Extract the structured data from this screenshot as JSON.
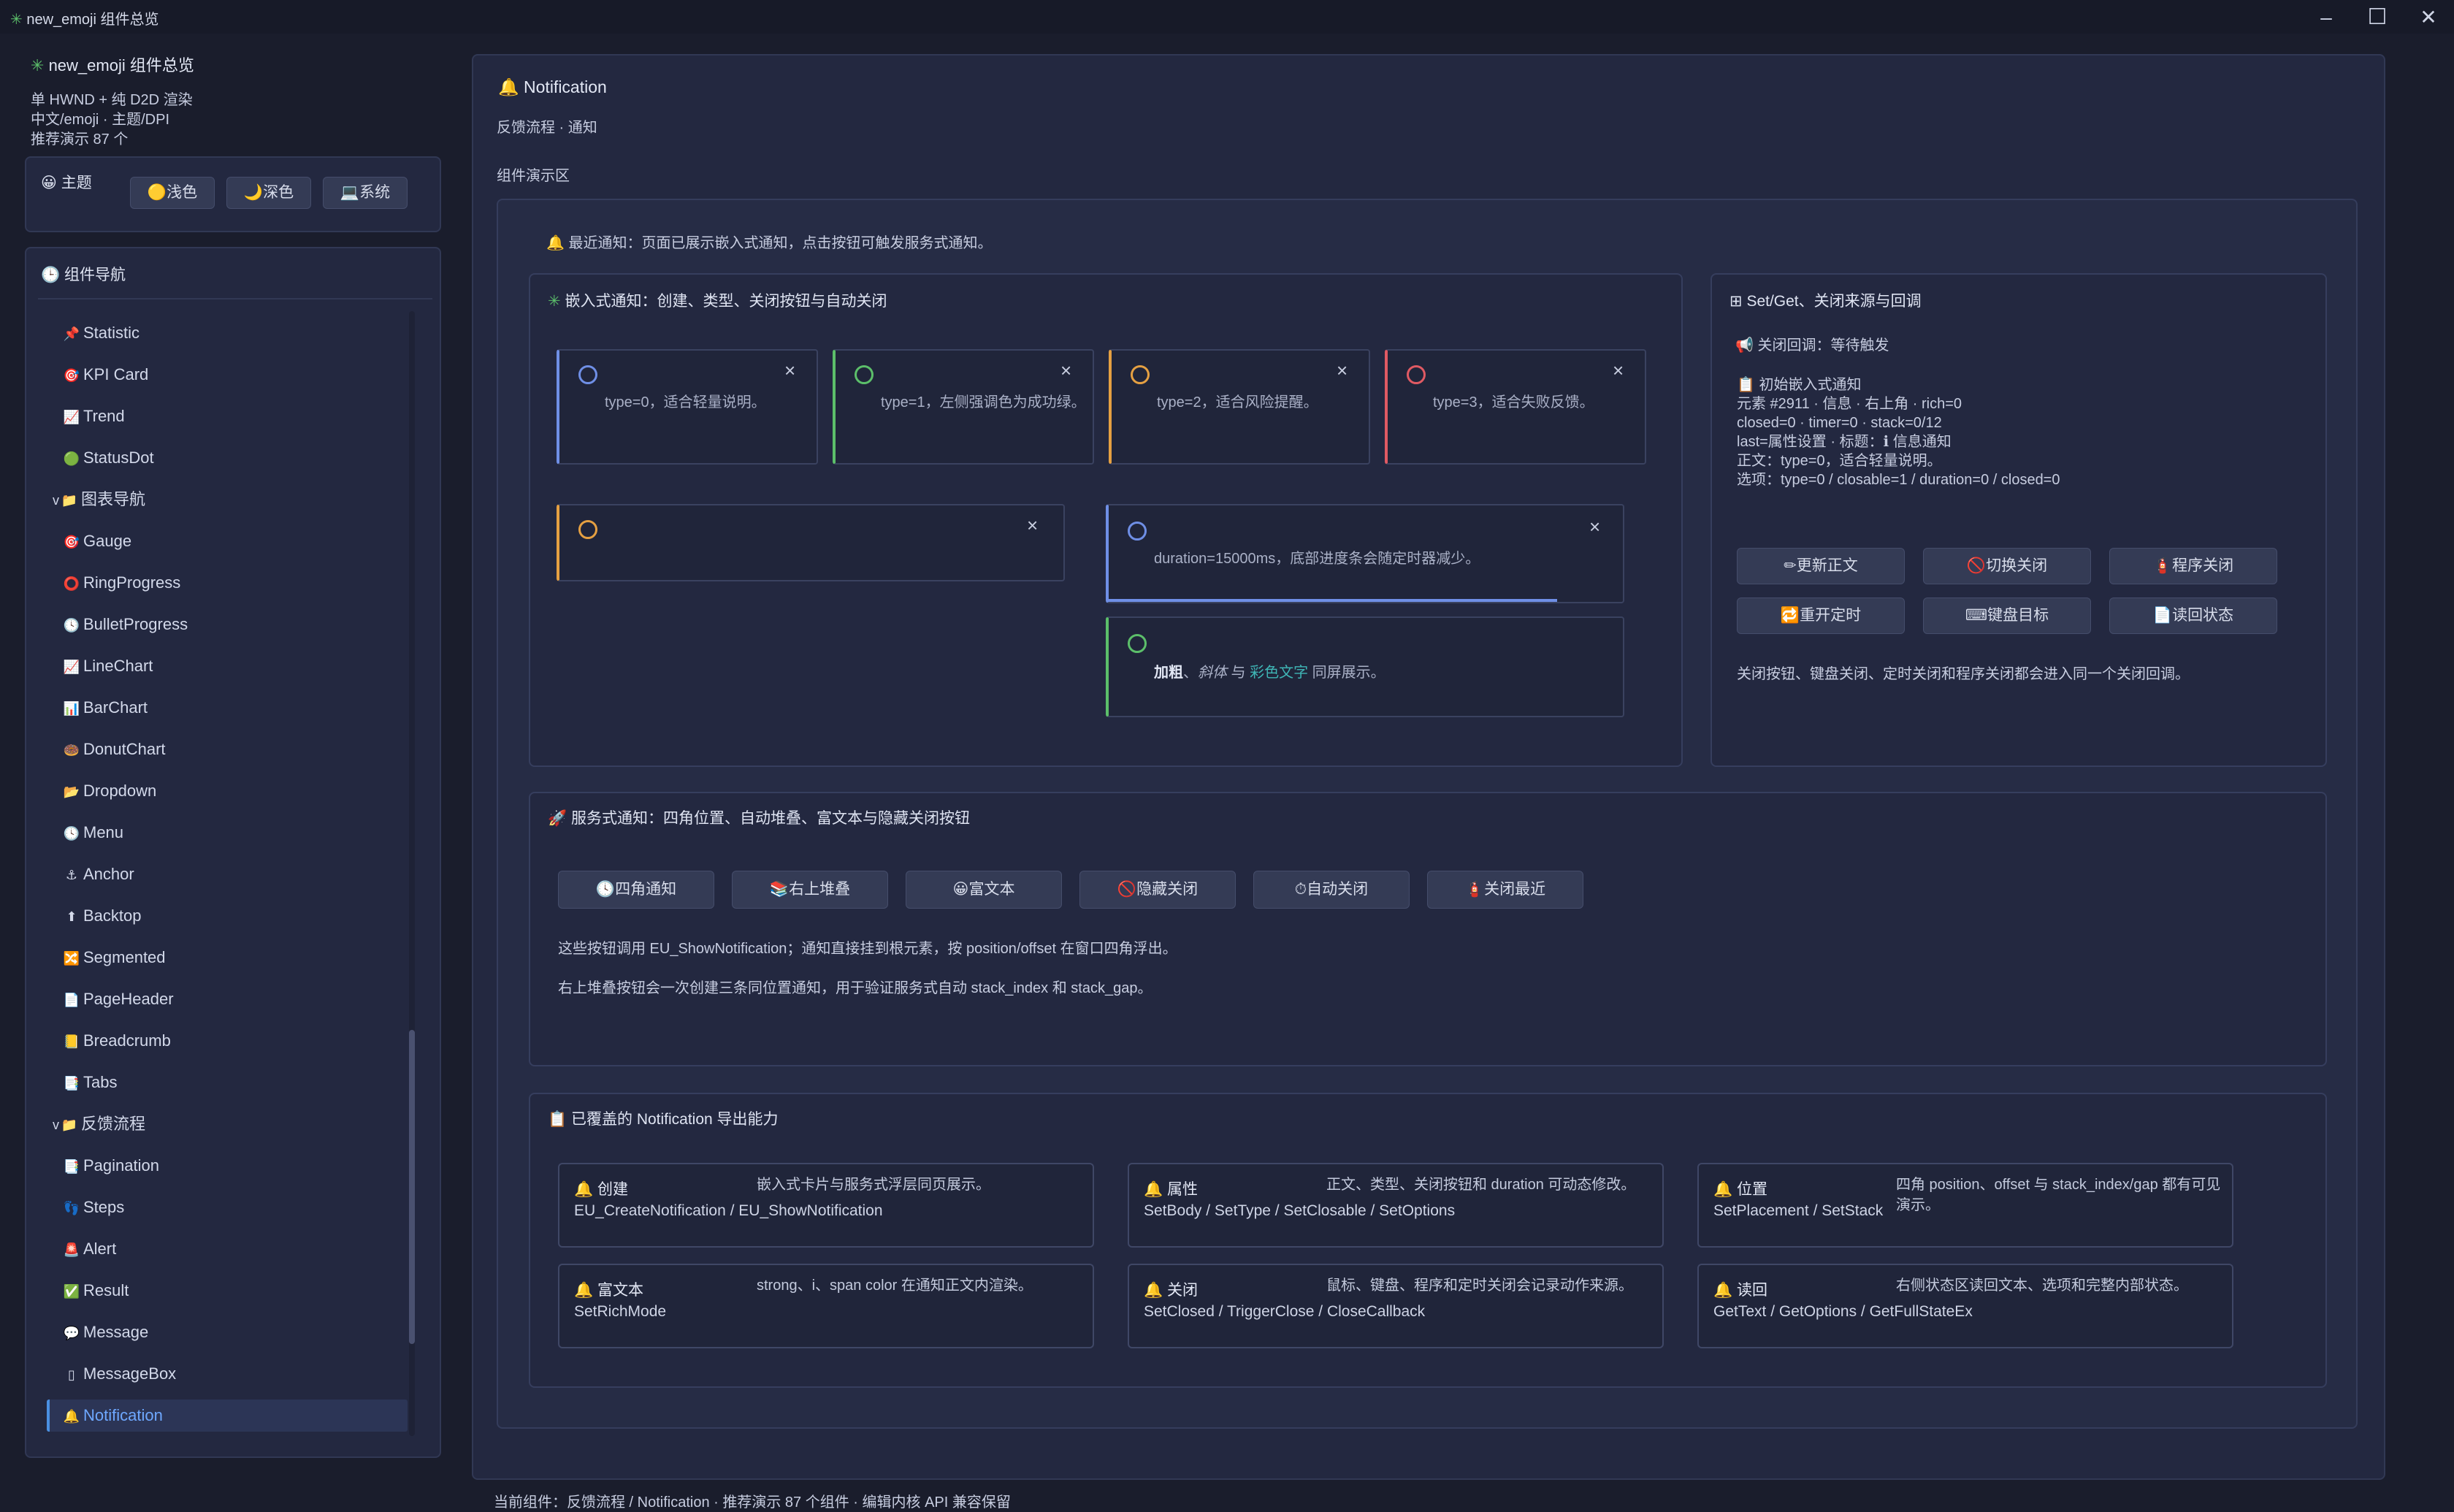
{
  "window": {
    "title": "new_emoji 组件总览"
  },
  "sidebar": {
    "app_title": "new_emoji 组件总览",
    "info": [
      "单 HWND + 纯 D2D 渲染",
      "中文/emoji · 主题/DPI",
      "推荐演示 87 个"
    ],
    "theme": {
      "label": "主题",
      "light": "浅色",
      "dark": "深色",
      "system": "系统"
    },
    "nav_title": "组件导航",
    "items": [
      {
        "label": "Statistic",
        "icon": "📌",
        "type": "item"
      },
      {
        "label": "KPI Card",
        "icon": "🎯",
        "type": "item"
      },
      {
        "label": "Trend",
        "icon": "📈",
        "type": "item"
      },
      {
        "label": "StatusDot",
        "icon": "🟢",
        "type": "item"
      },
      {
        "label": "图表导航",
        "icon": "📁",
        "type": "group"
      },
      {
        "label": "Gauge",
        "icon": "🎯",
        "type": "item"
      },
      {
        "label": "RingProgress",
        "icon": "⭕",
        "type": "item"
      },
      {
        "label": "BulletProgress",
        "icon": "🕓",
        "type": "item"
      },
      {
        "label": "LineChart",
        "icon": "📈",
        "type": "item"
      },
      {
        "label": "BarChart",
        "icon": "📊",
        "type": "item"
      },
      {
        "label": "DonutChart",
        "icon": "🍩",
        "type": "item"
      },
      {
        "label": "Dropdown",
        "icon": "📂",
        "type": "item"
      },
      {
        "label": "Menu",
        "icon": "🕓",
        "type": "item"
      },
      {
        "label": "Anchor",
        "icon": "⚓",
        "type": "item"
      },
      {
        "label": "Backtop",
        "icon": "⬆",
        "type": "item"
      },
      {
        "label": "Segmented",
        "icon": "🔀",
        "type": "item"
      },
      {
        "label": "PageHeader",
        "icon": "📄",
        "type": "item"
      },
      {
        "label": "Breadcrumb",
        "icon": "📒",
        "type": "item"
      },
      {
        "label": "Tabs",
        "icon": "📑",
        "type": "item"
      },
      {
        "label": "反馈流程",
        "icon": "📁",
        "type": "group"
      },
      {
        "label": "Pagination",
        "icon": "📑",
        "type": "item"
      },
      {
        "label": "Steps",
        "icon": "👣",
        "type": "item"
      },
      {
        "label": "Alert",
        "icon": "🚨",
        "type": "item"
      },
      {
        "label": "Result",
        "icon": "✅",
        "type": "item"
      },
      {
        "label": "Message",
        "icon": "💬",
        "type": "item"
      },
      {
        "label": "MessageBox",
        "icon": "▯",
        "type": "item"
      },
      {
        "label": "Notification",
        "icon": "🔔",
        "type": "item",
        "selected": true
      }
    ]
  },
  "main": {
    "title": "Notification",
    "subtitle": "反馈流程 · 通知",
    "demo_label": "组件演示区",
    "recent": "最近通知：页面已展示嵌入式通知，点击按钮可触发服务式通知。",
    "embedded": {
      "title": "嵌入式通知：创建、类型、关闭按钮与自动关闭",
      "cards": [
        {
          "text": "type=0，适合轻量说明。",
          "color": "#6f8fe6"
        },
        {
          "text": "type=1，左侧强调色为成功绿。",
          "color": "#5cbf6a"
        },
        {
          "text": "type=2，适合风险提醒。",
          "color": "#e5a042"
        },
        {
          "text": "type=3，适合失败反馈。",
          "color": "#e05a63"
        }
      ],
      "duration_text": "duration=15000ms，底部进度条会随定时器减少。",
      "rich": {
        "bold": "加粗",
        "sep1": "、",
        "italic": "斜体",
        "sep2": " 与 ",
        "colored": "彩色文字",
        "tail": " 同屏展示。"
      },
      "close_glyph": "×"
    },
    "setget": {
      "title": "Set/Get、关闭来源与回调",
      "callback": "关闭回调：等待触发",
      "lines": [
        "初始嵌入式通知",
        "元素 #2911 · 信息 · 右上角 · rich=0",
        "closed=0 · timer=0 · stack=0/12",
        "last=属性设置 · 标题：ℹ 信息通知",
        "正文：type=0，适合轻量说明。",
        "选项：type=0 / closable=1 / duration=0 / closed=0"
      ],
      "buttons": [
        "✏更新正文",
        "🚫切换关闭",
        "🧯程序关闭",
        "🔁重开定时",
        "⌨键盘目标",
        "📄读回状态"
      ],
      "note": "关闭按钮、键盘关闭、定时关闭和程序关闭都会进入同一个关闭回调。"
    },
    "service": {
      "title": "服务式通知：四角位置、自动堆叠、富文本与隐藏关闭按钮",
      "buttons": [
        "🕓四角通知",
        "📚右上堆叠",
        "😀富文本",
        "🚫隐藏关闭",
        "⏱自动关闭",
        "🧯关闭最近"
      ],
      "line1": "这些按钮调用 EU_ShowNotification；通知直接挂到根元素，按 position/offset 在窗口四角浮出。",
      "line2": "右上堆叠按钮会一次创建三条同位置通知，用于验证服务式自动 stack_index 和 stack_gap。"
    },
    "exports": {
      "title": "已覆盖的 Notification 导出能力",
      "features": [
        {
          "title": "创建",
          "desc": "嵌入式卡片与服务式浮层同页展示。",
          "api": "EU_CreateNotification / EU_ShowNotification"
        },
        {
          "title": "属性",
          "desc": "正文、类型、关闭按钮和 duration 可动态修改。",
          "api": "SetBody / SetType / SetClosable / SetOptions"
        },
        {
          "title": "位置",
          "desc": "四角 position、offset 与 stack_index/gap 都有可见演示。",
          "api": "SetPlacement / SetStack"
        },
        {
          "title": "富文本",
          "desc": "strong、i、span color 在通知正文内渲染。",
          "api": "SetRichMode"
        },
        {
          "title": "关闭",
          "desc": "鼠标、键盘、程序和定时关闭会记录动作来源。",
          "api": "SetClosed / TriggerClose / CloseCallback"
        },
        {
          "title": "读回",
          "desc": "右侧状态区读回文本、选项和完整内部状态。",
          "api": "GetText / GetOptions / GetFullStateEx"
        }
      ]
    }
  },
  "status_bar": "当前组件：反馈流程 / Notification · 推荐演示 87 个组件 · 编辑内核 API 兼容保留",
  "colors": {
    "accent": "#4a90e2",
    "bg": "#1a1d2c",
    "panel": "#232840"
  }
}
